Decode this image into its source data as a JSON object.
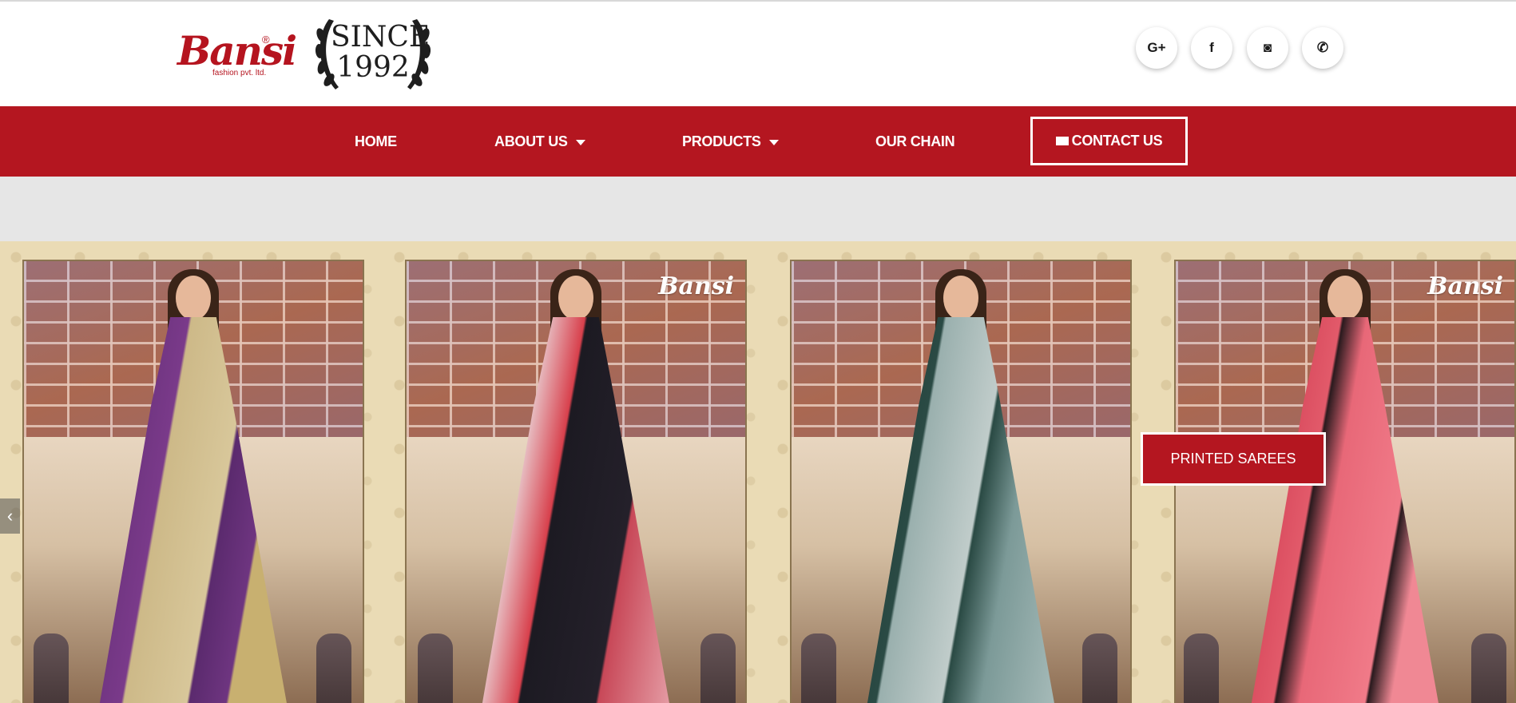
{
  "brand": {
    "name": "Bansi",
    "registered": "®",
    "subtitle": "fashion pvt. ltd."
  },
  "since_badge": {
    "line1": "SINCE",
    "line2": "1992"
  },
  "social": [
    {
      "icon": "google-plus-icon",
      "glyph": "G+"
    },
    {
      "icon": "facebook-icon",
      "glyph": "f"
    },
    {
      "icon": "instagram-icon",
      "glyph": "◙"
    },
    {
      "icon": "whatsapp-icon",
      "glyph": "✆"
    }
  ],
  "nav": {
    "home": "HOME",
    "about": "ABOUT US",
    "products": "PRODUCTS",
    "chain": "OUR CHAIN",
    "contact": "CONTACT US"
  },
  "slider": {
    "prev_glyph": "‹",
    "watermark": "Bansi",
    "cta": "PRINTED SAREES"
  },
  "colors": {
    "brand_red": "#b41620",
    "hero_bg": "#eadbb5",
    "strip_gray": "#e6e6e6"
  }
}
